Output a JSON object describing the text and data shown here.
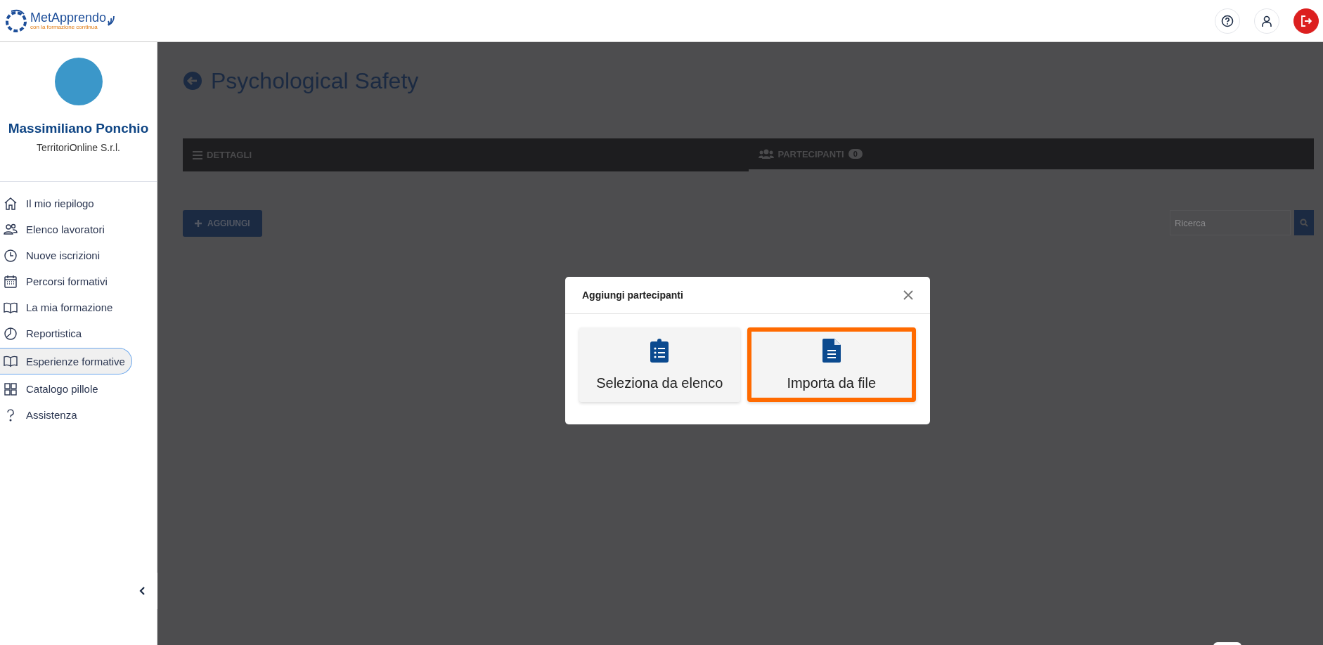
{
  "header": {
    "logo": {
      "name": "MetApprendo",
      "tagline": "con la formazione continua"
    }
  },
  "sidebar": {
    "user": {
      "name": "Massimiliano Ponchio",
      "company": "TerritoriOnline S.r.l."
    },
    "items": [
      {
        "label": "Il mio riepilogo",
        "selected": false
      },
      {
        "label": "Elenco lavoratori",
        "selected": false
      },
      {
        "label": "Nuove iscrizioni",
        "selected": false
      },
      {
        "label": "Percorsi formativi",
        "selected": false
      },
      {
        "label": "La mia formazione",
        "selected": false
      },
      {
        "label": "Reportistica",
        "selected": false
      },
      {
        "label": "Esperienze formative",
        "selected": true
      },
      {
        "label": "Catalogo pillole",
        "selected": false
      },
      {
        "label": "Assistenza",
        "selected": false
      }
    ]
  },
  "page": {
    "title": "Psychological Safety",
    "tabs": [
      {
        "label": "DETTAGLI",
        "selected": false
      },
      {
        "label": "PARTECIPANTI",
        "selected": true,
        "count": "0"
      }
    ],
    "add_button": "AGGIUNGI",
    "search": {
      "placeholder": "Ricerca"
    }
  },
  "modal": {
    "title": "Aggiungi partecipanti",
    "options": [
      {
        "label": "Seleziona da elenco",
        "selected": false
      },
      {
        "label": "Importa da file",
        "selected": true
      }
    ]
  }
}
